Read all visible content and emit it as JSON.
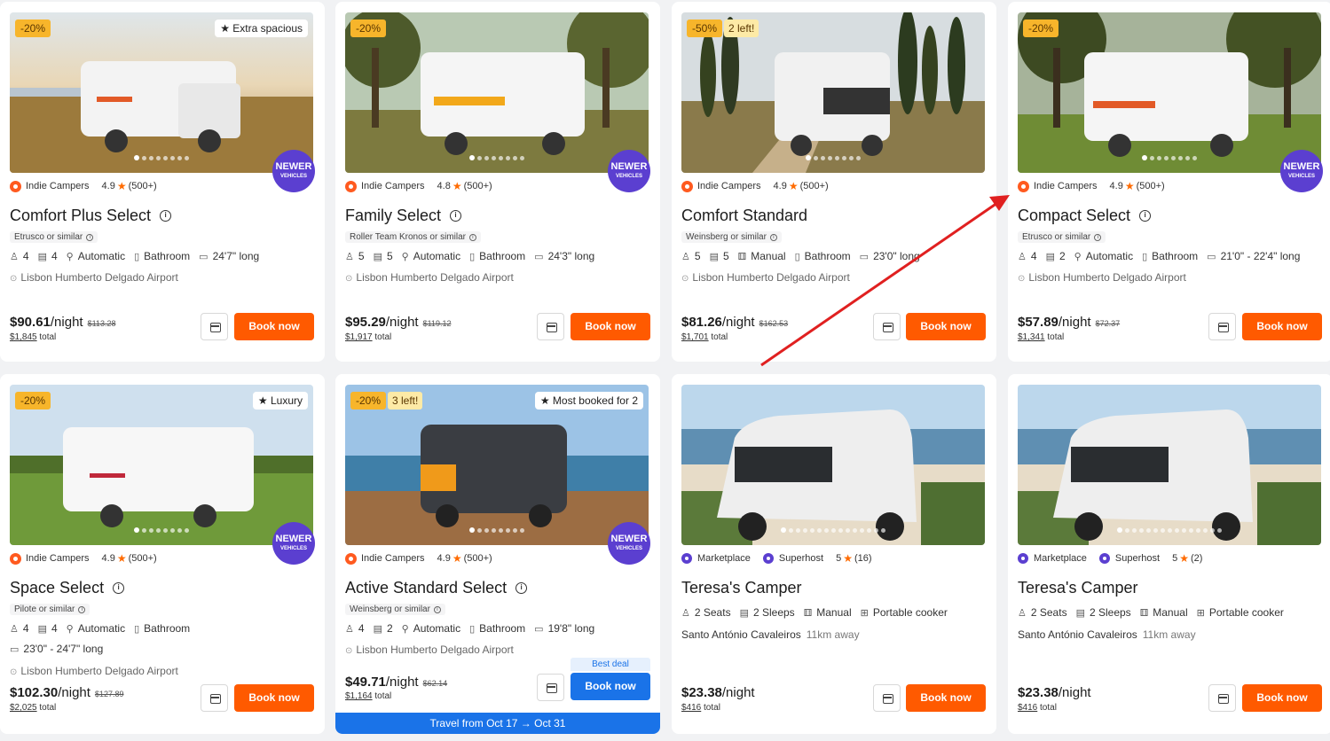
{
  "cards": [
    {
      "discount": "-20%",
      "tag": "★ Extra spacious",
      "newer": true,
      "brand": "Indie Campers",
      "rating": "4.9",
      "reviews": "(500+)",
      "title": "Comfort Plus Select",
      "similar": "Etrusco or similar",
      "seats": "4",
      "beds": "4",
      "transmission": "Automatic",
      "bathroom": "Bathroom",
      "length": "24'7\" long",
      "location": "Lisbon Humberto Delgado Airport",
      "price": "$90.61",
      "per": "/night",
      "old": "$113.28",
      "total": "$1,845",
      "total_label": "total",
      "book": "Book now",
      "scene": "coast"
    },
    {
      "discount": "-20%",
      "newer": true,
      "brand": "Indie Campers",
      "rating": "4.8",
      "reviews": "(500+)",
      "title": "Family Select",
      "similar": "Roller Team Kronos or similar",
      "seats": "5",
      "beds": "5",
      "transmission": "Automatic",
      "bathroom": "Bathroom",
      "length": "24'3\" long",
      "location": "Lisbon Humberto Delgado Airport",
      "price": "$95.29",
      "per": "/night",
      "old": "$119.12",
      "total": "$1,917",
      "total_label": "total",
      "book": "Book now",
      "scene": "forest"
    },
    {
      "discount": "-50%",
      "left": "2 left!",
      "newer": false,
      "brand": "Indie Campers",
      "rating": "4.9",
      "reviews": "(500+)",
      "title": "Comfort Standard",
      "similar": "Weinsberg or similar",
      "seats": "5",
      "beds": "5",
      "transmission": "Manual",
      "bathroom": "Bathroom",
      "length": "23'0\" long",
      "location": "Lisbon Humberto Delgado Airport",
      "price": "$81.26",
      "per": "/night",
      "old": "$162.53",
      "total": "$1,701",
      "total_label": "total",
      "book": "Book now",
      "scene": "cypress"
    },
    {
      "discount": "-20%",
      "newer": true,
      "brand": "Indie Campers",
      "rating": "4.9",
      "reviews": "(500+)",
      "title": "Compact Select",
      "similar": "Etrusco or similar",
      "seats": "4",
      "beds": "2",
      "transmission": "Automatic",
      "bathroom": "Bathroom",
      "length": "21'0\" - 22'4\" long",
      "location": "Lisbon Humberto Delgado Airport",
      "price": "$57.89",
      "per": "/night",
      "old": "$72.37",
      "total": "$1,341",
      "total_label": "total",
      "book": "Book now",
      "scene": "forest"
    },
    {
      "discount": "-20%",
      "tag": "★ Luxury",
      "newer": true,
      "brand": "Indie Campers",
      "rating": "4.9",
      "reviews": "(500+)",
      "title": "Space Select",
      "similar": "Pilote or similar",
      "seats": "4",
      "beds": "4",
      "transmission": "Automatic",
      "bathroom": "Bathroom",
      "length": "23'0\" - 24'7\" long",
      "location": "Lisbon Humberto Delgado Airport",
      "price": "$102.30",
      "per": "/night",
      "old": "$127.89",
      "total": "$2,025",
      "total_label": "total",
      "book": "Book now",
      "scene": "meadow"
    },
    {
      "discount": "-20%",
      "left": "3 left!",
      "tag": "★ Most booked for 2",
      "newer": true,
      "brand": "Indie Campers",
      "rating": "4.9",
      "reviews": "(500+)",
      "title": "Active Standard Select",
      "similar": "Weinsberg or similar",
      "seats": "4",
      "beds": "2",
      "transmission": "Automatic",
      "bathroom": "Bathroom",
      "length": "19'8\" long",
      "location": "Lisbon Humberto Delgado Airport",
      "price": "$49.71",
      "per": "/night",
      "old": "$62.14",
      "total": "$1,164",
      "total_label": "total",
      "book": "Book now",
      "best_deal": "Best deal",
      "travel": "Travel from Oct 17 → Oct 31",
      "scene": "sea"
    },
    {
      "brand": "Marketplace",
      "superhost": "Superhost",
      "rating": "5",
      "reviews": "(16)",
      "title": "Teresa's Camper",
      "seats": "2 Seats",
      "sleeps": "2 Sleeps",
      "transmission": "Manual",
      "cooker": "Portable cooker",
      "place": "Santo António Cavaleiros",
      "distance": "11km away",
      "price": "$23.38",
      "per": "/night",
      "total": "$416",
      "total_label": "total",
      "book": "Book now",
      "scene": "beach"
    },
    {
      "brand": "Marketplace",
      "superhost": "Superhost",
      "rating": "5",
      "reviews": "(2)",
      "title": "Teresa's Camper",
      "seats": "2 Seats",
      "sleeps": "2 Sleeps",
      "transmission": "Manual",
      "cooker": "Portable cooker",
      "place": "Santo António Cavaleiros",
      "distance": "11km away",
      "price": "$23.38",
      "per": "/night",
      "total": "$416",
      "total_label": "total",
      "book": "Book now",
      "scene": "beach"
    }
  ],
  "newer_badge": {
    "line1": "NEWER",
    "line2": "VEHICLES"
  },
  "annotation_arrow_color": "#e02020"
}
